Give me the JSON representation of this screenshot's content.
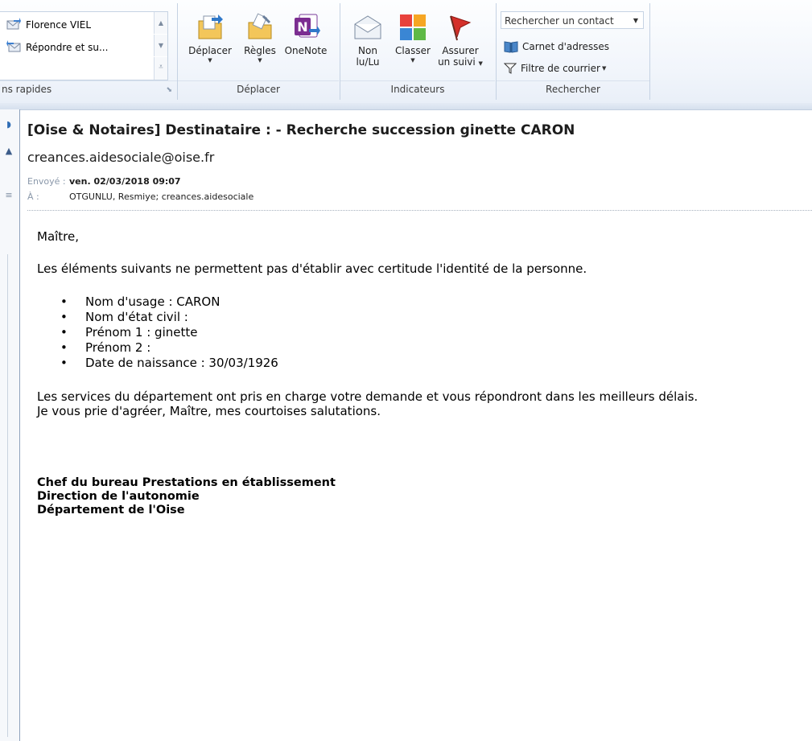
{
  "ribbon": {
    "quick_steps": {
      "items": [
        {
          "label": "Florence VIEL",
          "icon": "forward-envelope-icon"
        },
        {
          "label": "Répondre et su...",
          "icon": "reply-envelope-icon"
        }
      ],
      "group_label": "ns rapides"
    },
    "move": {
      "buttons": [
        {
          "label": "Déplacer",
          "icon": "move-folder-icon"
        },
        {
          "label": "Règles",
          "icon": "rules-icon"
        },
        {
          "label": "OneNote",
          "icon": "onenote-icon"
        }
      ],
      "group_label": "Déplacer"
    },
    "tags": {
      "buttons": [
        {
          "line1": "Non",
          "line2": "lu/Lu",
          "icon": "envelope-read-icon"
        },
        {
          "line1": "Classer",
          "line2": "",
          "icon": "categorize-icon"
        },
        {
          "line1": "Assurer",
          "line2": "un suivi",
          "icon": "flag-icon"
        }
      ],
      "group_label": "Indicateurs"
    },
    "find": {
      "search_placeholder": "Rechercher un contact",
      "address_book": "Carnet d'adresses",
      "filter_mail": "Filtre de courrier",
      "group_label": "Rechercher"
    }
  },
  "message": {
    "subject": "[Oise & Notaires] Destinataire :  - Recherche succession ginette CARON",
    "sender": "creances.aidesociale@oise.fr",
    "sent_label": "Envoyé :",
    "sent_value": "ven. 02/03/2018 09:07",
    "to_label": "À :",
    "to_value": "OTGUNLU, Resmiye; creances.aidesociale"
  },
  "body": {
    "greeting": "Maître,",
    "intro": "Les éléments suivants ne permettent pas d'établir avec certitude l'identité de la personne.",
    "bullets": [
      "Nom d'usage : CARON",
      "Nom d'état civil :",
      "Prénom 1 : ginette",
      "Prénom 2 :",
      "Date de naissance : 30/03/1926"
    ],
    "line1": "Les services du département ont pris en charge votre demande et vous répondront dans les meilleurs délais.",
    "line2": "Je vous prie d'agréer, Maître, mes courtoises salutations.",
    "signature": [
      "Chef du bureau Prestations en établissement",
      "Direction de l'autonomie",
      "Département de l'Oise"
    ]
  }
}
